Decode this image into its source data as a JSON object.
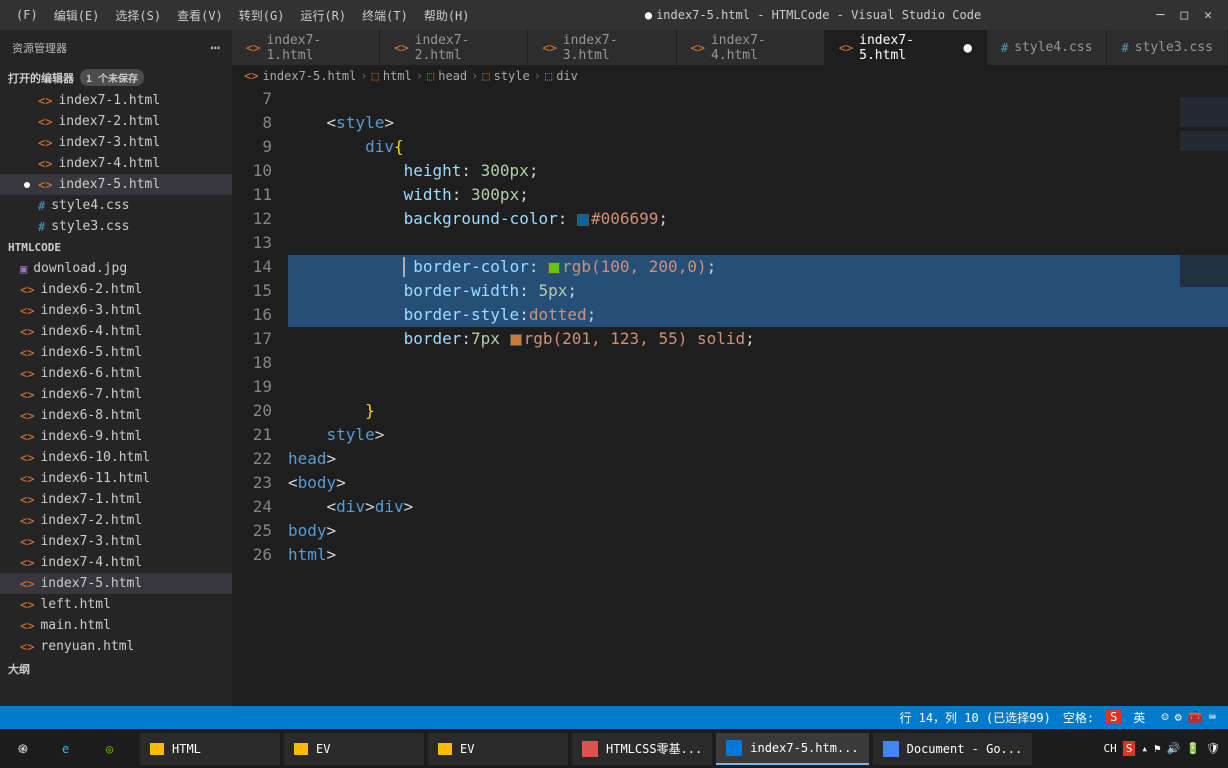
{
  "menubar": {
    "items": [
      "(F)",
      "编辑(E)",
      "选择(S)",
      "查看(V)",
      "转到(G)",
      "运行(R)",
      "终端(T)",
      "帮助(H)"
    ],
    "title": "index7-5.html - HTMLCode - Visual Studio Code"
  },
  "sidebar": {
    "title": "资源管理器",
    "openEditorsLabel": "打开的编辑器",
    "unsavedBadge": "1 个未保存",
    "openEditors": [
      {
        "name": "index7-1.html",
        "icon": "html",
        "dirty": false
      },
      {
        "name": "index7-2.html",
        "icon": "html",
        "dirty": false
      },
      {
        "name": "index7-3.html",
        "icon": "html",
        "dirty": false
      },
      {
        "name": "index7-4.html",
        "icon": "html",
        "dirty": false
      },
      {
        "name": "index7-5.html",
        "icon": "html",
        "dirty": true,
        "active": true
      },
      {
        "name": "style4.css",
        "icon": "css",
        "dirty": false
      },
      {
        "name": "style3.css",
        "icon": "css",
        "dirty": false
      }
    ],
    "folderName": "HTMLCODE",
    "files": [
      {
        "name": "download.jpg",
        "icon": "img"
      },
      {
        "name": "index6-2.html",
        "icon": "html"
      },
      {
        "name": "index6-3.html",
        "icon": "html"
      },
      {
        "name": "index6-4.html",
        "icon": "html"
      },
      {
        "name": "index6-5.html",
        "icon": "html"
      },
      {
        "name": "index6-6.html",
        "icon": "html"
      },
      {
        "name": "index6-7.html",
        "icon": "html"
      },
      {
        "name": "index6-8.html",
        "icon": "html"
      },
      {
        "name": "index6-9.html",
        "icon": "html"
      },
      {
        "name": "index6-10.html",
        "icon": "html"
      },
      {
        "name": "index6-11.html",
        "icon": "html"
      },
      {
        "name": "index7-1.html",
        "icon": "html"
      },
      {
        "name": "index7-2.html",
        "icon": "html"
      },
      {
        "name": "index7-3.html",
        "icon": "html"
      },
      {
        "name": "index7-4.html",
        "icon": "html"
      },
      {
        "name": "index7-5.html",
        "icon": "html",
        "active": true
      },
      {
        "name": "left.html",
        "icon": "html"
      },
      {
        "name": "main.html",
        "icon": "html"
      },
      {
        "name": "renyuan.html",
        "icon": "html"
      }
    ],
    "outlineLabel": "大纲"
  },
  "tabs": [
    {
      "name": "index7-1.html",
      "icon": "html"
    },
    {
      "name": "index7-2.html",
      "icon": "html"
    },
    {
      "name": "index7-3.html",
      "icon": "html"
    },
    {
      "name": "index7-4.html",
      "icon": "html"
    },
    {
      "name": "index7-5.html",
      "icon": "html",
      "active": true,
      "dirty": true
    },
    {
      "name": "style4.css",
      "icon": "css"
    },
    {
      "name": "style3.css",
      "icon": "css"
    }
  ],
  "breadcrumb": [
    "index7-5.html",
    "html",
    "head",
    "style",
    "div"
  ],
  "code": {
    "startLine": 7,
    "lines": [
      {
        "n": 7,
        "indent": "",
        "tokens": []
      },
      {
        "n": 8,
        "indent": "    ",
        "raw": "<style>"
      },
      {
        "n": 9,
        "indent": "        ",
        "raw": "div{"
      },
      {
        "n": 10,
        "indent": "            ",
        "raw": "height: 300px;"
      },
      {
        "n": 11,
        "indent": "            ",
        "raw": "width: 300px;"
      },
      {
        "n": 12,
        "indent": "            ",
        "raw": "background-color: #006699;",
        "color": "#006699"
      },
      {
        "n": 13,
        "indent": "",
        "raw": ""
      },
      {
        "n": 14,
        "indent": "            ",
        "raw": " border-color: rgb(100, 200,0);",
        "color": "rgb(100,200,0)",
        "selected": true,
        "cursor": true
      },
      {
        "n": 15,
        "indent": "            ",
        "raw": "border-width: 5px;",
        "selected": true
      },
      {
        "n": 16,
        "indent": "            ",
        "raw": "border-style:dotted;",
        "selected": true
      },
      {
        "n": 17,
        "indent": "            ",
        "raw": "border:7px rgb(201, 123, 55) solid;",
        "color": "rgb(201,123,55)"
      },
      {
        "n": 18,
        "indent": "",
        "raw": ""
      },
      {
        "n": 19,
        "indent": "",
        "raw": ""
      },
      {
        "n": 20,
        "indent": "        ",
        "raw": "}"
      },
      {
        "n": 21,
        "indent": "    ",
        "raw": "</style>"
      },
      {
        "n": 22,
        "indent": "",
        "raw": "</head>"
      },
      {
        "n": 23,
        "indent": "",
        "raw": "<body>"
      },
      {
        "n": 24,
        "indent": "    ",
        "raw": "<div></div>"
      },
      {
        "n": 25,
        "indent": "",
        "raw": "</body>"
      },
      {
        "n": 26,
        "indent": "",
        "raw": "</html>"
      }
    ]
  },
  "statusbar": {
    "position": "行 14，列 10 (已选择99)",
    "spaces": "空格:",
    "imeLabel": "S",
    "imeLang": "英"
  },
  "taskbar": {
    "items": [
      {
        "label": "HTML",
        "type": "folder"
      },
      {
        "label": "EV",
        "type": "folder"
      },
      {
        "label": "EV",
        "type": "folder"
      },
      {
        "label": "HTMLCSS零基...",
        "type": "app",
        "iconColor": "#d9534f"
      },
      {
        "label": "index7-5.htm...",
        "type": "app",
        "iconColor": "#0078d7",
        "active": true
      },
      {
        "label": "Document - Go...",
        "type": "app",
        "iconColor": "#4285f4"
      }
    ],
    "trayLabel": "CH"
  }
}
